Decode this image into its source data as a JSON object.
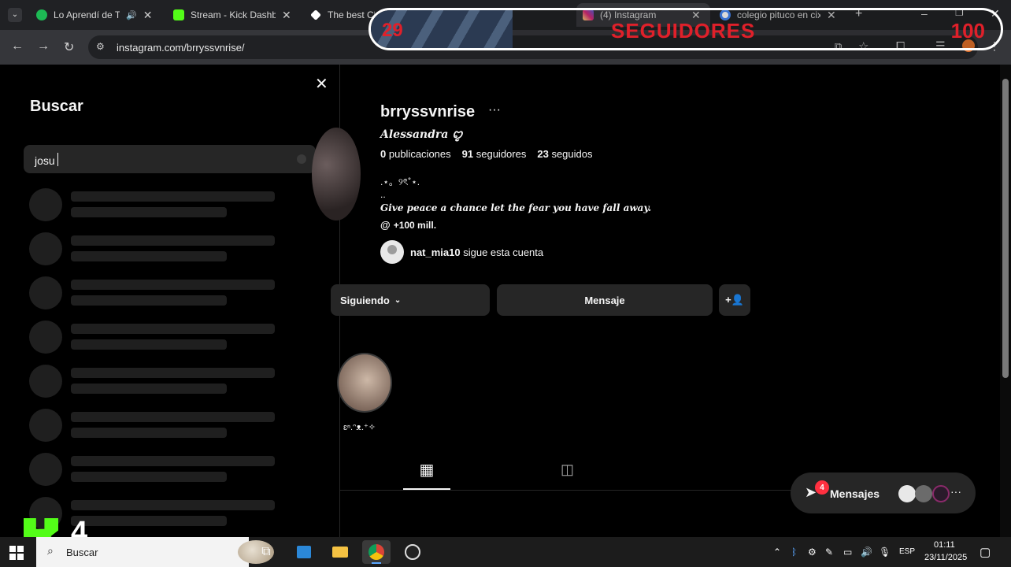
{
  "browser": {
    "tabs": [
      {
        "title": "Lo Aprendí de Ti",
        "favicon": "spotify-icon",
        "color": "#1db954"
      },
      {
        "title": "Stream - Kick Dashbo",
        "favicon": "kick-icon",
        "color": "#53fc18"
      },
      {
        "title": "The best Ch",
        "favicon": "diamond-icon",
        "color": "#ffffff"
      },
      {
        "title": "(4) Instagram",
        "favicon": "instagram-icon",
        "color": "#e1306c"
      },
      {
        "title": "colegio pituco en cix",
        "favicon": "google-icon",
        "color": "#4285f4"
      }
    ],
    "url": "instagram.com/brryssvnrise/"
  },
  "overlay": {
    "current": "29",
    "label": "SEGUIDORES",
    "goal": "100",
    "progress_fraction": 0.29,
    "text_color": "#e0202a"
  },
  "search_panel": {
    "title": "Buscar",
    "query": "josu",
    "skeleton_rows": 8
  },
  "profile": {
    "username": "brryssvnrise",
    "full_name": "𝑨𝒍𝒆𝒔𝒔𝒂𝒏𝒅𝒓𝒂 ꨄ︎",
    "stats": {
      "posts_count": "0",
      "posts_label": "publicaciones",
      "followers_count": "91",
      "followers_label": "seguidores",
      "following_count": "23",
      "following_label": "seguidos"
    },
    "bio_line1": ".⋆。୨ৎ˚⋆.",
    "bio_line2": "..",
    "bio_quote": "Give peace a chance let the fear you have fall away.",
    "threads_label": "+100 mill.",
    "followed_by_user": "nat_mia10",
    "followed_by_text": "sigue esta cuenta",
    "buttons": {
      "following": "Siguiendo",
      "message": "Mensaje"
    },
    "highlight_label": "ɛⁿ.ᵔᴥ.⁺✧"
  },
  "messages": {
    "label": "Mensajes",
    "badge": "4"
  },
  "kick_overlay": {
    "count": "4"
  },
  "taskbar": {
    "search_label": "Buscar",
    "language": "ESP",
    "time": "01:11",
    "date": "23/11/2025"
  }
}
